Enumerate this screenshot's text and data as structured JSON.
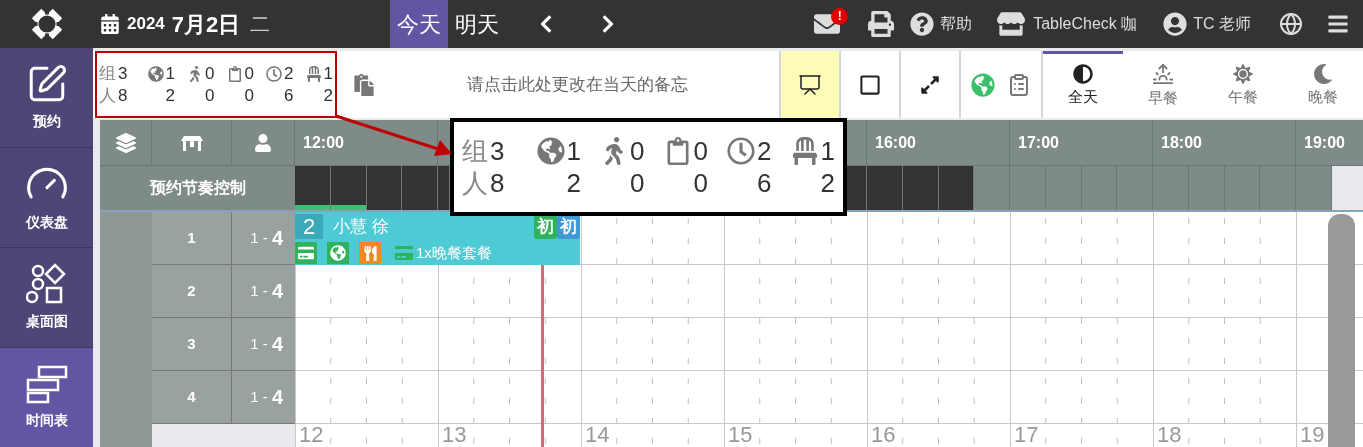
{
  "topbar": {
    "date": {
      "year": "2024",
      "day": "7月2日",
      "weekday": "二"
    },
    "day_buttons": [
      {
        "label": "今天",
        "selected": true
      },
      {
        "label": "明天",
        "selected": false
      }
    ],
    "mail_badge": "!",
    "help": "帮助",
    "store": "TableCheck 咖",
    "user": "TC 老师"
  },
  "sidebar": {
    "items": [
      {
        "label": "预约",
        "kind": "edit",
        "selected": false
      },
      {
        "label": "仪表盘",
        "kind": "gauge",
        "selected": false
      },
      {
        "label": "桌面图",
        "kind": "shapes",
        "selected": false
      },
      {
        "label": "时间表",
        "kind": "timeline",
        "selected": true
      }
    ]
  },
  "summary": {
    "icon_columns": [
      {
        "kind": "web"
      },
      {
        "kind": "walk_in"
      },
      {
        "kind": "waitlist"
      },
      {
        "kind": "pending"
      },
      {
        "kind": "seated"
      }
    ],
    "rows": [
      {
        "label": "组",
        "values": [
          "3",
          "1",
          "0",
          "0",
          "2",
          "1"
        ]
      },
      {
        "label": "人",
        "values": [
          "8",
          "2",
          "0",
          "0",
          "6",
          "2"
        ]
      }
    ]
  },
  "memo": {
    "placeholder": "请点击此处更改在当天的备忘"
  },
  "toggles": [
    {
      "kind": "easel",
      "on": true
    },
    {
      "kind": "square",
      "on": false
    },
    {
      "kind": "expand",
      "on": false
    }
  ],
  "meal_tabs": [
    {
      "label": "全天",
      "kind": "all",
      "selected": true
    },
    {
      "label": "早餐",
      "kind": "breakfast",
      "selected": false
    },
    {
      "label": "午餐",
      "kind": "lunch",
      "selected": false
    },
    {
      "label": "晚餐",
      "kind": "dinner",
      "selected": false
    }
  ],
  "timeline": {
    "hour_headers_left": [
      "12:00"
    ],
    "hour_headers_right": [
      "16:00",
      "17:00",
      "18:00",
      "19:00"
    ],
    "pacing_label": "预约节奏控制",
    "pacing_slots_left": [
      {
        "blocked": true,
        "booked": true
      },
      {
        "blocked": true,
        "booked": true
      },
      {
        "blocked": true,
        "booked": false
      },
      {
        "blocked": true,
        "booked": false
      },
      {
        "blocked": true,
        "booked": false
      }
    ],
    "pacing_slots_right": [
      {
        "blocked": true,
        "booked": false
      },
      {
        "blocked": true,
        "booked": false
      },
      {
        "blocked": true,
        "booked": false
      },
      {
        "blocked": true,
        "booked": false
      },
      {
        "blocked": false,
        "booked": false
      },
      {
        "blocked": false,
        "booked": false
      },
      {
        "blocked": false,
        "booked": false
      },
      {
        "blocked": false,
        "booked": false
      },
      {
        "blocked": false,
        "booked": false
      },
      {
        "blocked": false,
        "booked": false
      },
      {
        "blocked": false,
        "booked": false
      },
      {
        "blocked": false,
        "booked": false
      },
      {
        "blocked": false,
        "booked": false
      },
      {
        "blocked": false,
        "booked": false
      }
    ],
    "rows": [
      {
        "table": "1",
        "capacity_min": "1 -",
        "capacity_max": "4",
        "reservation": {
          "party": "2",
          "name": "小慧 徐",
          "tags": [
            {
              "label": "初",
              "color": "#2eb35a"
            },
            {
              "label": "初",
              "color": "#3d9ad6"
            }
          ],
          "icons": [
            {
              "kind": "card"
            },
            {
              "kind": "web"
            },
            {
              "kind": "food"
            }
          ],
          "course": "1x晚餐套餐"
        }
      },
      {
        "table": "2",
        "capacity_min": "1 -",
        "capacity_max": "4"
      },
      {
        "table": "3",
        "capacity_min": "1 -",
        "capacity_max": "4"
      },
      {
        "table": "4",
        "capacity_min": "1 -",
        "capacity_max": "4"
      }
    ],
    "footer_hours": [
      "12",
      "13",
      "14",
      "15",
      "16",
      "17",
      "18",
      "19"
    ]
  },
  "callout": {
    "rows": [
      {
        "label": "组",
        "values": [
          "3",
          "1",
          "0",
          "0",
          "2",
          "1"
        ]
      },
      {
        "label": "人",
        "values": [
          "8",
          "2",
          "0",
          "0",
          "6",
          "2"
        ]
      }
    ]
  }
}
